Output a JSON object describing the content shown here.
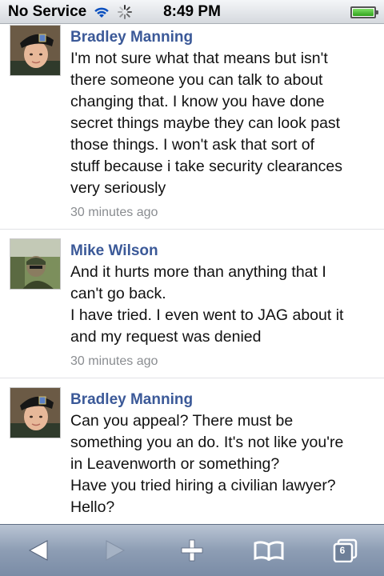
{
  "status_bar": {
    "carrier": "No Service",
    "time": "8:49 PM"
  },
  "posts": [
    {
      "author": "Bradley Manning",
      "message": "I'm not sure what that means but isn't\nthere someone you can talk to about\nchanging that. I know you have done\nsecret things maybe they can look past\nthose things. I won't ask that sort of\nstuff because i take security clearances\nvery seriously",
      "time": "30 minutes ago"
    },
    {
      "author": "Mike Wilson",
      "message": "And it hurts more than anything that I\ncan't go back.\nI have tried. I even went to JAG about it\nand my request was denied",
      "time": "30 minutes ago"
    },
    {
      "author": "Bradley Manning",
      "message": "Can you appeal? There must be\nsomething you an do. It's not like you're\nin Leavenworth or something?\nHave you tried hiring a civilian lawyer?\nHello?",
      "time": ""
    }
  ],
  "toolbar": {
    "back_icon": "back-arrow-icon",
    "forward_icon": "forward-arrow-icon",
    "add_icon": "plus-icon",
    "bookmarks_icon": "book-icon",
    "tabs_icon": "pages-icon",
    "tab_count": "6"
  },
  "colors": {
    "author": "#3b5998",
    "timestamp": "#8a8d91",
    "toolbar": "#8d9db4",
    "battery": "#2fa21b"
  }
}
